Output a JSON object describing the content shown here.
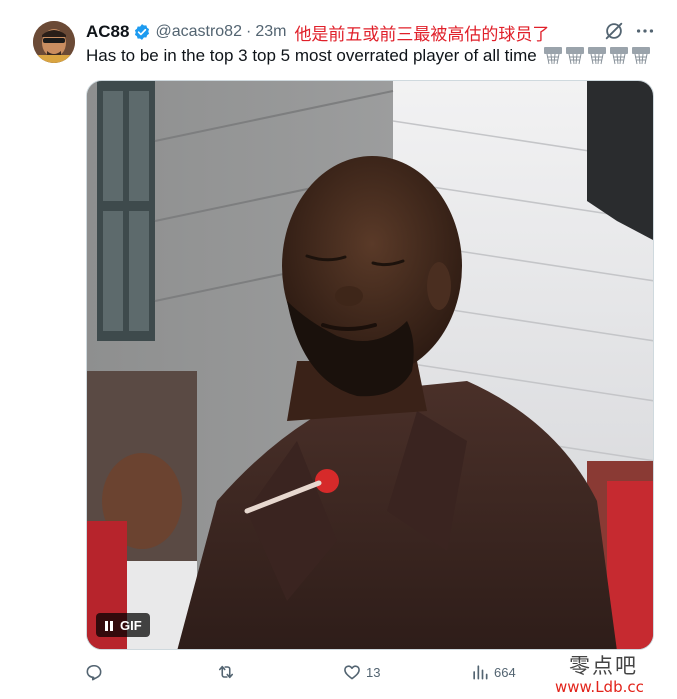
{
  "tweet": {
    "author": {
      "display_name": "AC88",
      "handle": "@acastro82",
      "verified": true
    },
    "separator": "·",
    "time": "23m",
    "overlay_caption": "他是前五或前三最被高估的球员了",
    "text": "Has to be in the top 3 top 5 most overrated player of all time",
    "emoji": [
      "basketball-hoop",
      "basketball-hoop",
      "basketball-hoop",
      "basketball-hoop",
      "basketball-hoop"
    ],
    "media": {
      "type": "GIF",
      "badge_label": "GIF",
      "playing": true
    },
    "actions": {
      "replies": "",
      "reposts": "",
      "likes": "13",
      "views": "664"
    }
  },
  "watermark": {
    "line1": "零点吧",
    "line2": "www.Ldb.cc"
  },
  "colors": {
    "primary_text": "#0f1419",
    "secondary_text": "#536471",
    "verified_blue": "#1d9bf0",
    "overlay_red": "#e0202a",
    "watermark_red": "#e2231a"
  }
}
